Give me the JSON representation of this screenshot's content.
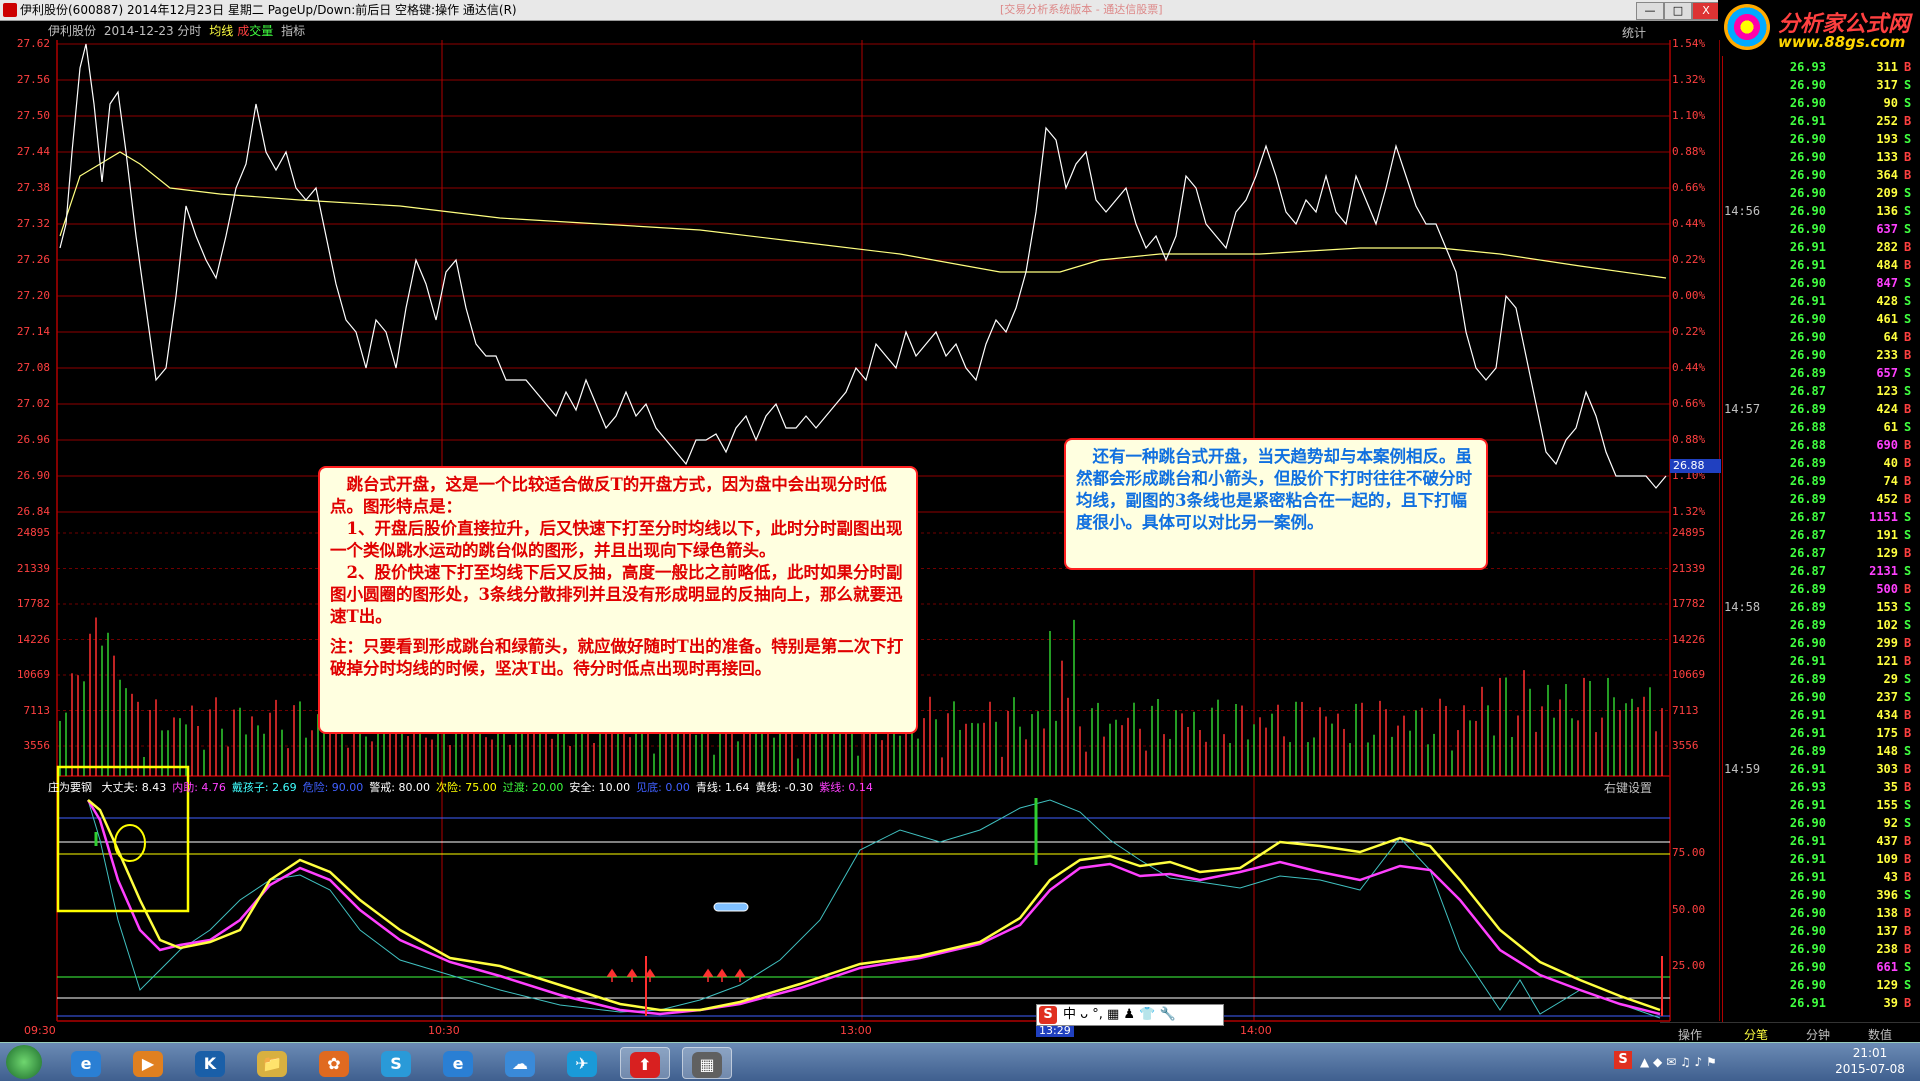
{
  "window": {
    "title": "伊利股份(600887) 2014年12月23日 星期二 PageUp/Down:前后日 空格键:操作 通达信(R)",
    "center_title": "[交易分析系统版本 - 通达信股票]",
    "btn_min": "—",
    "btn_max": "□",
    "btn_close": "X"
  },
  "logo": {
    "line1": "分析家公式网",
    "line2": "www.88gs.com"
  },
  "chart": {
    "header": {
      "stock": "伊利股份",
      "date": "2014-12-23 分时",
      "avg": "均线",
      "vol_a": "成",
      "vol_b": "交量",
      "ind": "指标"
    },
    "stat": "统计",
    "price_labels": [
      "27.62",
      "27.56",
      "27.50",
      "27.44",
      "27.38",
      "27.32",
      "27.26",
      "27.20",
      "27.14",
      "27.08",
      "27.02",
      "26.96",
      "26.90",
      "26.84"
    ],
    "pct_labels": [
      "1.54%",
      "1.32%",
      "1.10%",
      "0.88%",
      "0.66%",
      "0.44%",
      "0.22%",
      "0.00%",
      "0.22%",
      "0.44%",
      "0.66%",
      "0.88%",
      "1.10%",
      "1.32%"
    ],
    "current_price": "26.88",
    "volume_labels": [
      "24895",
      "21339",
      "17782",
      "14226",
      "10669",
      "7113",
      "3556"
    ],
    "time_labels": [
      "09:30",
      "10:30",
      "13:00",
      "13:29",
      "14:00"
    ]
  },
  "indicator": {
    "name": "庄为要钢",
    "items": [
      {
        "label": "大丈夫:",
        "value": "8.43",
        "color": "#ffffff"
      },
      {
        "label": "内助:",
        "value": "4.76",
        "color": "#ff40ff"
      },
      {
        "label": "戴孩子:",
        "value": "2.69",
        "color": "#40ffff"
      },
      {
        "label": "危险:",
        "value": "90.00",
        "color": "#4060ff"
      },
      {
        "label": "警戒:",
        "value": "80.00",
        "color": "#ffffff"
      },
      {
        "label": "次险:",
        "value": "75.00",
        "color": "#ffff00"
      },
      {
        "label": "过渡:",
        "value": "20.00",
        "color": "#40ff40"
      },
      {
        "label": "安全:",
        "value": "10.00",
        "color": "#ffffff"
      },
      {
        "label": "见底:",
        "value": "0.00",
        "color": "#4060ff"
      },
      {
        "label": "青线:",
        "value": "1.64",
        "color": "#ffffff"
      },
      {
        "label": "黄线:",
        "value": "-0.30",
        "color": "#ffffff"
      },
      {
        "label": "紫线:",
        "value": "0.14",
        "color": "#ff40ff"
      }
    ],
    "right_setting": "右键设置",
    "level_labels": [
      "75.00",
      "50.00",
      "25.00"
    ]
  },
  "notes": {
    "note1": [
      "　跳台式开盘，这是一个比较适合做反T的开盘方式，因为盘中会出现分时低点。图形特点是：",
      "　1、开盘后股价直接拉升，后又快速下打至分时均线以下，此时分时副图出现一个类似跳水运动的跳台似的图形，并且出现向下绿色箭头。",
      "　2、股价快速下打至均线下后又反抽，高度一般比之前略低，此时如果分时副图小圆圈的图形处，3条线分散排列并且没有形成明显的反抽向上，那么就要迅速T出。",
      "注：只要看到形成跳台和绿箭头，就应做好随时T出的准备。特别是第二次下打破掉分时均线的时候，坚决T出。待分时低点出现时再接回。"
    ],
    "note2": "　还有一种跳台式开盘，当天趋势却与本案例相反。虽然都会形成跳台和小箭头，但股价下打时往往不破分时均线，副图的3条线也是紧密粘合在一起的，且下打幅度很小。具体可以对比另一案例。"
  },
  "ticks": {
    "time_marks": [
      {
        "row": 8,
        "t": "14:56"
      },
      {
        "row": 19,
        "t": "14:57"
      },
      {
        "row": 30,
        "t": "14:58"
      },
      {
        "row": 39,
        "t": "14:59"
      }
    ],
    "rows": [
      {
        "p": "26.93",
        "v": "311",
        "s": "B"
      },
      {
        "p": "26.90",
        "v": "317",
        "s": "S"
      },
      {
        "p": "26.90",
        "v": "90",
        "s": "S"
      },
      {
        "p": "26.91",
        "v": "252",
        "s": "B"
      },
      {
        "p": "26.90",
        "v": "193",
        "s": "S"
      },
      {
        "p": "26.90",
        "v": "133",
        "s": "B"
      },
      {
        "p": "26.90",
        "v": "364",
        "s": "B"
      },
      {
        "p": "26.90",
        "v": "209",
        "s": "S"
      },
      {
        "p": "26.90",
        "v": "136",
        "s": "S"
      },
      {
        "p": "26.90",
        "v": "637",
        "s": "S"
      },
      {
        "p": "26.91",
        "v": "282",
        "s": "B"
      },
      {
        "p": "26.91",
        "v": "484",
        "s": "B"
      },
      {
        "p": "26.90",
        "v": "847",
        "s": "S"
      },
      {
        "p": "26.91",
        "v": "428",
        "s": "S"
      },
      {
        "p": "26.90",
        "v": "461",
        "s": "S"
      },
      {
        "p": "26.90",
        "v": "64",
        "s": "B"
      },
      {
        "p": "26.90",
        "v": "233",
        "s": "B"
      },
      {
        "p": "26.89",
        "v": "657",
        "s": "S"
      },
      {
        "p": "26.87",
        "v": "123",
        "s": "S"
      },
      {
        "p": "26.89",
        "v": "424",
        "s": "B"
      },
      {
        "p": "26.88",
        "v": "61",
        "s": "S"
      },
      {
        "p": "26.88",
        "v": "690",
        "s": "B"
      },
      {
        "p": "26.89",
        "v": "40",
        "s": "B"
      },
      {
        "p": "26.89",
        "v": "74",
        "s": "B"
      },
      {
        "p": "26.89",
        "v": "452",
        "s": "B"
      },
      {
        "p": "26.87",
        "v": "1151",
        "s": "S"
      },
      {
        "p": "26.87",
        "v": "191",
        "s": "S"
      },
      {
        "p": "26.87",
        "v": "129",
        "s": "B"
      },
      {
        "p": "26.87",
        "v": "2131",
        "s": "S"
      },
      {
        "p": "26.89",
        "v": "500",
        "s": "B"
      },
      {
        "p": "26.89",
        "v": "153",
        "s": "S"
      },
      {
        "p": "26.89",
        "v": "102",
        "s": "S"
      },
      {
        "p": "26.90",
        "v": "299",
        "s": "B"
      },
      {
        "p": "26.91",
        "v": "121",
        "s": "B"
      },
      {
        "p": "26.89",
        "v": "29",
        "s": "S"
      },
      {
        "p": "26.90",
        "v": "237",
        "s": "S"
      },
      {
        "p": "26.91",
        "v": "434",
        "s": "B"
      },
      {
        "p": "26.91",
        "v": "175",
        "s": "B"
      },
      {
        "p": "26.89",
        "v": "148",
        "s": "S"
      },
      {
        "p": "26.91",
        "v": "303",
        "s": "B"
      },
      {
        "p": "26.93",
        "v": "35",
        "s": "B"
      },
      {
        "p": "26.91",
        "v": "155",
        "s": "S"
      },
      {
        "p": "26.90",
        "v": "92",
        "s": "S"
      },
      {
        "p": "26.91",
        "v": "437",
        "s": "B"
      },
      {
        "p": "26.91",
        "v": "109",
        "s": "B"
      },
      {
        "p": "26.91",
        "v": "43",
        "s": "B"
      },
      {
        "p": "26.90",
        "v": "396",
        "s": "S"
      },
      {
        "p": "26.90",
        "v": "138",
        "s": "B"
      },
      {
        "p": "26.90",
        "v": "137",
        "s": "B"
      },
      {
        "p": "26.90",
        "v": "238",
        "s": "B"
      },
      {
        "p": "26.90",
        "v": "661",
        "s": "S"
      },
      {
        "p": "26.90",
        "v": "129",
        "s": "S"
      },
      {
        "p": "26.91",
        "v": "39",
        "s": "B"
      }
    ]
  },
  "side_tabs": {
    "op": "操作",
    "t1": "分笔",
    "t2": "分钟",
    "t3": "数值"
  },
  "ime": {
    "text": "中 ᴗ °, ▦ ♟ 👕 🔧"
  },
  "taskbar": {
    "icons": [
      "ie-icon",
      "media-icon",
      "k-icon",
      "folder-icon",
      "paint-icon",
      "s-icon",
      "ie2-icon",
      "cloud-icon",
      "qq-icon",
      "tdx-icon",
      "chart-app-icon"
    ],
    "tray_lang": "S",
    "time": "21:01",
    "date": "2015-07-08"
  },
  "colors": {
    "grid_red": "#b00000",
    "price_line": "#ffffff",
    "avg_line": "#ffff80",
    "up": "#ff3030",
    "down": "#30d030"
  }
}
